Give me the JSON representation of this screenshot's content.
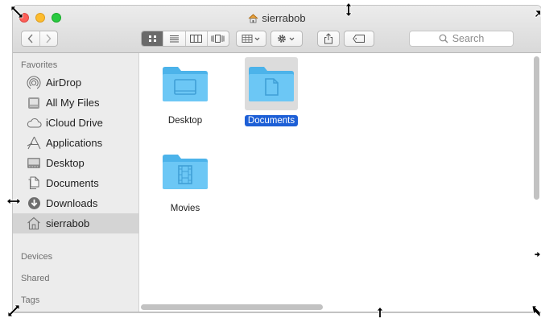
{
  "window": {
    "title": "sierrabob"
  },
  "toolbar": {
    "search_placeholder": "Search"
  },
  "sidebar": {
    "favorites_heading": "Favorites",
    "favorites": [
      {
        "label": "AirDrop",
        "icon": "airdrop-icon"
      },
      {
        "label": "All My Files",
        "icon": "all-my-files-icon"
      },
      {
        "label": "iCloud Drive",
        "icon": "icloud-icon"
      },
      {
        "label": "Applications",
        "icon": "applications-icon"
      },
      {
        "label": "Desktop",
        "icon": "desktop-icon"
      },
      {
        "label": "Documents",
        "icon": "documents-icon"
      },
      {
        "label": "Downloads",
        "icon": "downloads-icon"
      },
      {
        "label": "sierrabob",
        "icon": "home-icon",
        "selected": true
      }
    ],
    "devices_heading": "Devices",
    "shared_heading": "Shared",
    "tags_heading": "Tags"
  },
  "files": [
    {
      "name": "Desktop",
      "icon": "folder-icon"
    },
    {
      "name": "Documents",
      "icon": "folder-documents-icon",
      "selected": true
    },
    {
      "name": "Movies",
      "icon": "folder-movies-icon"
    }
  ],
  "colors": {
    "folder": "#5fc3f4",
    "selection": "#1d5fd6",
    "sidebar_bg": "#ececec"
  }
}
